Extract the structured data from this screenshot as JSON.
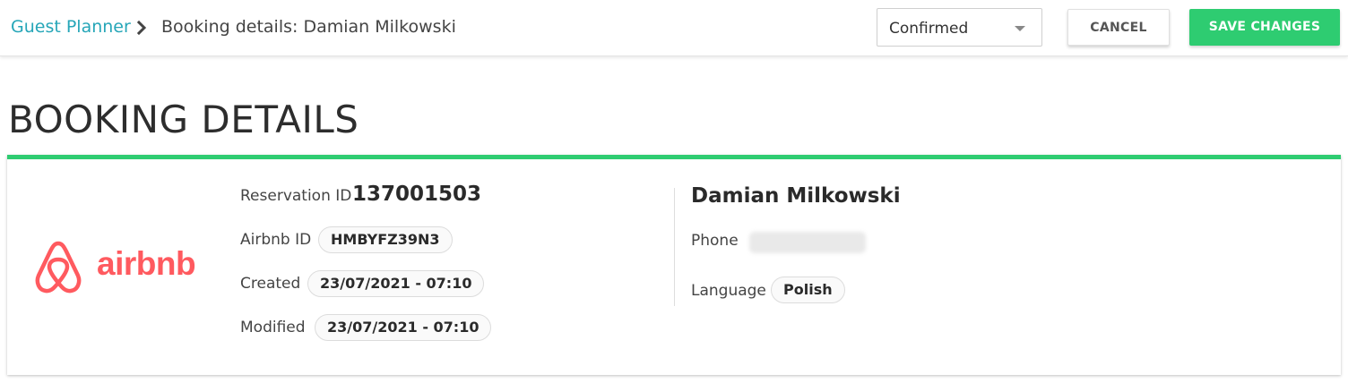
{
  "topbar": {
    "breadcrumb_home": "Guest Planner",
    "breadcrumb_current": "Booking details: Damian Milkowski",
    "status_value": "Confirmed",
    "cancel_label": "CANCEL",
    "save_label": "SAVE CHANGES"
  },
  "page": {
    "title": "BOOKING DETAILS"
  },
  "booking": {
    "source_logo": "airbnb",
    "reservation_id_label": "Reservation ID",
    "reservation_id": "137001503",
    "airbnb_id_label": "Airbnb ID",
    "airbnb_id": "HMBYFZ39N3",
    "created_label": "Created",
    "created": "23/07/2021 - 07:10",
    "modified_label": "Modified",
    "modified": "23/07/2021 - 07:10"
  },
  "guest": {
    "name": "Damian Milkowski",
    "phone_label": "Phone",
    "language_label": "Language",
    "language": "Polish"
  },
  "colors": {
    "accent_green": "#2ecc71",
    "link_teal": "#26a6b8",
    "airbnb_red": "#ff5a5f"
  },
  "icons": {
    "breadcrumb_separator": "chevron-right-icon",
    "select_caret": "caret-down-icon",
    "source_logo": "airbnb-logo-icon"
  }
}
